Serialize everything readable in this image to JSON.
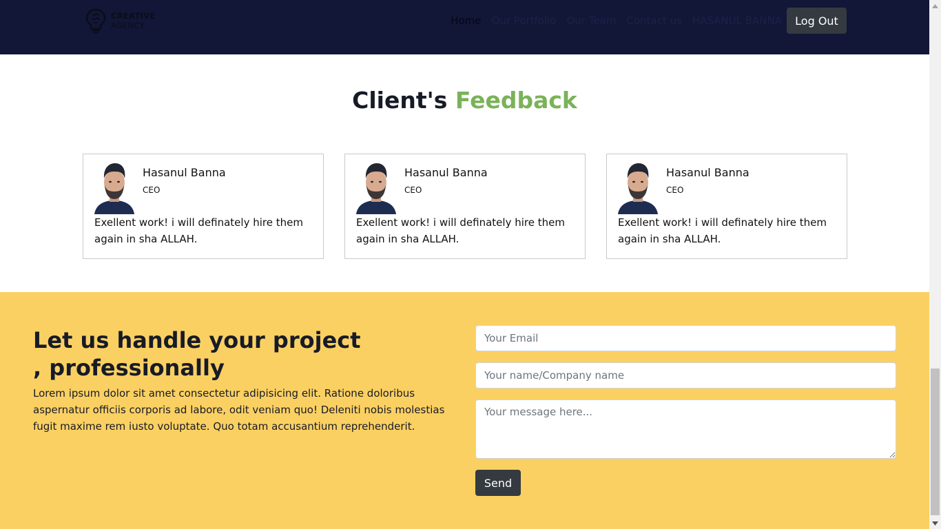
{
  "navbar": {
    "brand": {
      "line1": "CREATIVE",
      "line2": "AGENCY"
    },
    "links": [
      {
        "label": "Home"
      },
      {
        "label": "Our Portfolio"
      },
      {
        "label": "Our Team"
      },
      {
        "label": "Contact us"
      },
      {
        "label": "HASANUL BANNA"
      }
    ],
    "logout_label": "Log Out"
  },
  "feedback": {
    "title_main": "Client's",
    "title_accent": "Feedback",
    "cards": [
      {
        "name": "Hasanul Banna",
        "role": "CEO",
        "text": "Exellent work! i will definately hire them again in sha ALLAH."
      },
      {
        "name": "Hasanul Banna",
        "role": "CEO",
        "text": "Exellent work! i will definately hire them again in sha ALLAH."
      },
      {
        "name": "Hasanul Banna",
        "role": "CEO",
        "text": "Exellent work! i will definately hire them again in sha ALLAH."
      }
    ]
  },
  "contact": {
    "heading": "Let us handle your project , professionally",
    "body": "Lorem ipsum dolor sit amet consectetur adipisicing elit. Ratione doloribus aspernatur officiis corporis ad labore, odit veniam quo! Deleniti nobis molestias fugit maxime rem iusto voluptate. Quo totam accusantium reprehenderit.",
    "email_placeholder": "Your Email",
    "name_placeholder": "Your name/Company name",
    "message_placeholder": "Your message here...",
    "send_label": "Send"
  },
  "colors": {
    "navbar_bg": "#121738",
    "accent_green": "#7ab259",
    "contact_bg": "#fbd062",
    "button_dark": "#343a40"
  },
  "icons": {
    "brand": "lightbulb-brain-icon",
    "avatar": "person-photo-icon"
  }
}
